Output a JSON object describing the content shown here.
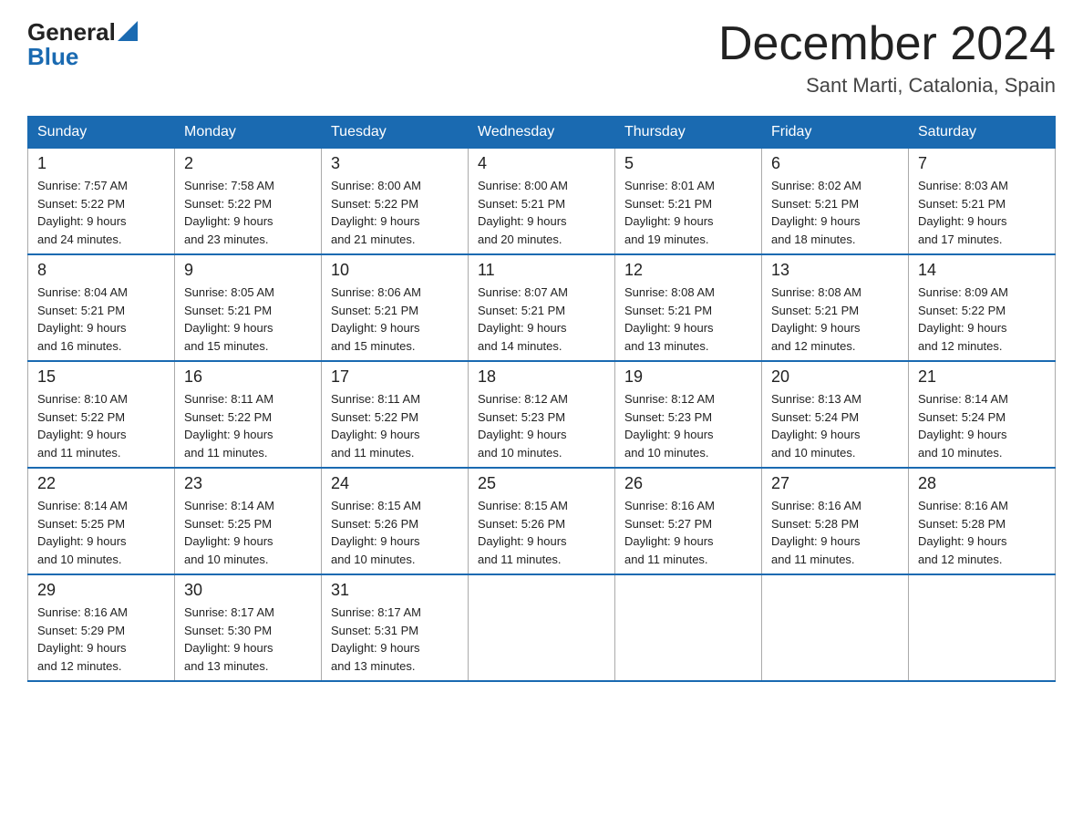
{
  "logo": {
    "line1": "General",
    "line2": "Blue"
  },
  "title": "December 2024",
  "subtitle": "Sant Marti, Catalonia, Spain",
  "headers": [
    "Sunday",
    "Monday",
    "Tuesday",
    "Wednesday",
    "Thursday",
    "Friday",
    "Saturday"
  ],
  "weeks": [
    [
      {
        "day": "1",
        "info": "Sunrise: 7:57 AM\nSunset: 5:22 PM\nDaylight: 9 hours\nand 24 minutes."
      },
      {
        "day": "2",
        "info": "Sunrise: 7:58 AM\nSunset: 5:22 PM\nDaylight: 9 hours\nand 23 minutes."
      },
      {
        "day": "3",
        "info": "Sunrise: 8:00 AM\nSunset: 5:22 PM\nDaylight: 9 hours\nand 21 minutes."
      },
      {
        "day": "4",
        "info": "Sunrise: 8:00 AM\nSunset: 5:21 PM\nDaylight: 9 hours\nand 20 minutes."
      },
      {
        "day": "5",
        "info": "Sunrise: 8:01 AM\nSunset: 5:21 PM\nDaylight: 9 hours\nand 19 minutes."
      },
      {
        "day": "6",
        "info": "Sunrise: 8:02 AM\nSunset: 5:21 PM\nDaylight: 9 hours\nand 18 minutes."
      },
      {
        "day": "7",
        "info": "Sunrise: 8:03 AM\nSunset: 5:21 PM\nDaylight: 9 hours\nand 17 minutes."
      }
    ],
    [
      {
        "day": "8",
        "info": "Sunrise: 8:04 AM\nSunset: 5:21 PM\nDaylight: 9 hours\nand 16 minutes."
      },
      {
        "day": "9",
        "info": "Sunrise: 8:05 AM\nSunset: 5:21 PM\nDaylight: 9 hours\nand 15 minutes."
      },
      {
        "day": "10",
        "info": "Sunrise: 8:06 AM\nSunset: 5:21 PM\nDaylight: 9 hours\nand 15 minutes."
      },
      {
        "day": "11",
        "info": "Sunrise: 8:07 AM\nSunset: 5:21 PM\nDaylight: 9 hours\nand 14 minutes."
      },
      {
        "day": "12",
        "info": "Sunrise: 8:08 AM\nSunset: 5:21 PM\nDaylight: 9 hours\nand 13 minutes."
      },
      {
        "day": "13",
        "info": "Sunrise: 8:08 AM\nSunset: 5:21 PM\nDaylight: 9 hours\nand 12 minutes."
      },
      {
        "day": "14",
        "info": "Sunrise: 8:09 AM\nSunset: 5:22 PM\nDaylight: 9 hours\nand 12 minutes."
      }
    ],
    [
      {
        "day": "15",
        "info": "Sunrise: 8:10 AM\nSunset: 5:22 PM\nDaylight: 9 hours\nand 11 minutes."
      },
      {
        "day": "16",
        "info": "Sunrise: 8:11 AM\nSunset: 5:22 PM\nDaylight: 9 hours\nand 11 minutes."
      },
      {
        "day": "17",
        "info": "Sunrise: 8:11 AM\nSunset: 5:22 PM\nDaylight: 9 hours\nand 11 minutes."
      },
      {
        "day": "18",
        "info": "Sunrise: 8:12 AM\nSunset: 5:23 PM\nDaylight: 9 hours\nand 10 minutes."
      },
      {
        "day": "19",
        "info": "Sunrise: 8:12 AM\nSunset: 5:23 PM\nDaylight: 9 hours\nand 10 minutes."
      },
      {
        "day": "20",
        "info": "Sunrise: 8:13 AM\nSunset: 5:24 PM\nDaylight: 9 hours\nand 10 minutes."
      },
      {
        "day": "21",
        "info": "Sunrise: 8:14 AM\nSunset: 5:24 PM\nDaylight: 9 hours\nand 10 minutes."
      }
    ],
    [
      {
        "day": "22",
        "info": "Sunrise: 8:14 AM\nSunset: 5:25 PM\nDaylight: 9 hours\nand 10 minutes."
      },
      {
        "day": "23",
        "info": "Sunrise: 8:14 AM\nSunset: 5:25 PM\nDaylight: 9 hours\nand 10 minutes."
      },
      {
        "day": "24",
        "info": "Sunrise: 8:15 AM\nSunset: 5:26 PM\nDaylight: 9 hours\nand 10 minutes."
      },
      {
        "day": "25",
        "info": "Sunrise: 8:15 AM\nSunset: 5:26 PM\nDaylight: 9 hours\nand 11 minutes."
      },
      {
        "day": "26",
        "info": "Sunrise: 8:16 AM\nSunset: 5:27 PM\nDaylight: 9 hours\nand 11 minutes."
      },
      {
        "day": "27",
        "info": "Sunrise: 8:16 AM\nSunset: 5:28 PM\nDaylight: 9 hours\nand 11 minutes."
      },
      {
        "day": "28",
        "info": "Sunrise: 8:16 AM\nSunset: 5:28 PM\nDaylight: 9 hours\nand 12 minutes."
      }
    ],
    [
      {
        "day": "29",
        "info": "Sunrise: 8:16 AM\nSunset: 5:29 PM\nDaylight: 9 hours\nand 12 minutes."
      },
      {
        "day": "30",
        "info": "Sunrise: 8:17 AM\nSunset: 5:30 PM\nDaylight: 9 hours\nand 13 minutes."
      },
      {
        "day": "31",
        "info": "Sunrise: 8:17 AM\nSunset: 5:31 PM\nDaylight: 9 hours\nand 13 minutes."
      },
      null,
      null,
      null,
      null
    ]
  ]
}
